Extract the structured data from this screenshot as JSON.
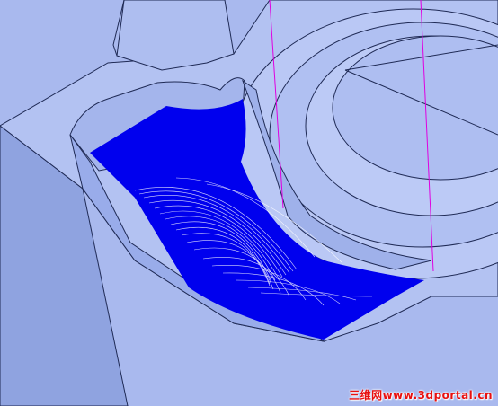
{
  "viewport": {
    "background_color": "#a9b9ee",
    "part_face_color": "#b4c3f3",
    "part_shadow_color": "#8ea2e0",
    "edge_color": "#1f2a55",
    "toolpath_color": "#0000ee",
    "toolpath_line_color": "#ffffff",
    "tool_axis_color": "#e000e0"
  },
  "watermark": {
    "text": "三维网www.3dportal.cn",
    "color": "#e81010"
  }
}
